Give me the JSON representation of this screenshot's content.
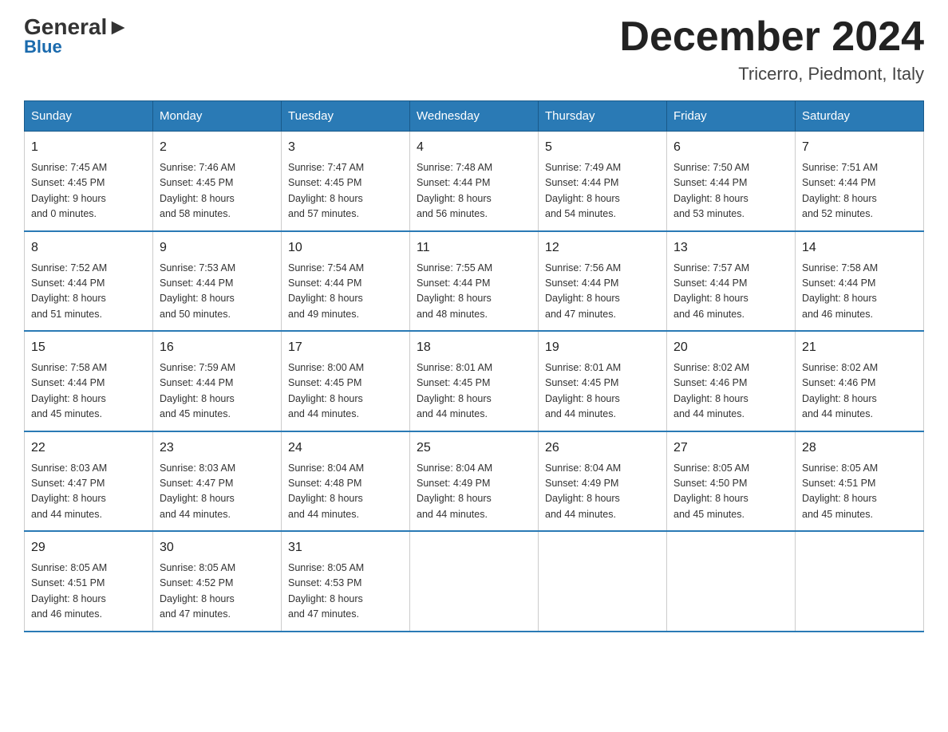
{
  "header": {
    "logo_general": "General",
    "logo_blue": "Blue",
    "month_title": "December 2024",
    "location": "Tricerro, Piedmont, Italy"
  },
  "days_of_week": [
    "Sunday",
    "Monday",
    "Tuesday",
    "Wednesday",
    "Thursday",
    "Friday",
    "Saturday"
  ],
  "weeks": [
    [
      {
        "day": "1",
        "sunrise": "7:45 AM",
        "sunset": "4:45 PM",
        "daylight_h": "9",
        "daylight_m": "0"
      },
      {
        "day": "2",
        "sunrise": "7:46 AM",
        "sunset": "4:45 PM",
        "daylight_h": "8",
        "daylight_m": "58"
      },
      {
        "day": "3",
        "sunrise": "7:47 AM",
        "sunset": "4:45 PM",
        "daylight_h": "8",
        "daylight_m": "57"
      },
      {
        "day": "4",
        "sunrise": "7:48 AM",
        "sunset": "4:44 PM",
        "daylight_h": "8",
        "daylight_m": "56"
      },
      {
        "day": "5",
        "sunrise": "7:49 AM",
        "sunset": "4:44 PM",
        "daylight_h": "8",
        "daylight_m": "54"
      },
      {
        "day": "6",
        "sunrise": "7:50 AM",
        "sunset": "4:44 PM",
        "daylight_h": "8",
        "daylight_m": "53"
      },
      {
        "day": "7",
        "sunrise": "7:51 AM",
        "sunset": "4:44 PM",
        "daylight_h": "8",
        "daylight_m": "52"
      }
    ],
    [
      {
        "day": "8",
        "sunrise": "7:52 AM",
        "sunset": "4:44 PM",
        "daylight_h": "8",
        "daylight_m": "51"
      },
      {
        "day": "9",
        "sunrise": "7:53 AM",
        "sunset": "4:44 PM",
        "daylight_h": "8",
        "daylight_m": "50"
      },
      {
        "day": "10",
        "sunrise": "7:54 AM",
        "sunset": "4:44 PM",
        "daylight_h": "8",
        "daylight_m": "49"
      },
      {
        "day": "11",
        "sunrise": "7:55 AM",
        "sunset": "4:44 PM",
        "daylight_h": "8",
        "daylight_m": "48"
      },
      {
        "day": "12",
        "sunrise": "7:56 AM",
        "sunset": "4:44 PM",
        "daylight_h": "8",
        "daylight_m": "47"
      },
      {
        "day": "13",
        "sunrise": "7:57 AM",
        "sunset": "4:44 PM",
        "daylight_h": "8",
        "daylight_m": "46"
      },
      {
        "day": "14",
        "sunrise": "7:58 AM",
        "sunset": "4:44 PM",
        "daylight_h": "8",
        "daylight_m": "46"
      }
    ],
    [
      {
        "day": "15",
        "sunrise": "7:58 AM",
        "sunset": "4:44 PM",
        "daylight_h": "8",
        "daylight_m": "45"
      },
      {
        "day": "16",
        "sunrise": "7:59 AM",
        "sunset": "4:44 PM",
        "daylight_h": "8",
        "daylight_m": "45"
      },
      {
        "day": "17",
        "sunrise": "8:00 AM",
        "sunset": "4:45 PM",
        "daylight_h": "8",
        "daylight_m": "44"
      },
      {
        "day": "18",
        "sunrise": "8:01 AM",
        "sunset": "4:45 PM",
        "daylight_h": "8",
        "daylight_m": "44"
      },
      {
        "day": "19",
        "sunrise": "8:01 AM",
        "sunset": "4:45 PM",
        "daylight_h": "8",
        "daylight_m": "44"
      },
      {
        "day": "20",
        "sunrise": "8:02 AM",
        "sunset": "4:46 PM",
        "daylight_h": "8",
        "daylight_m": "44"
      },
      {
        "day": "21",
        "sunrise": "8:02 AM",
        "sunset": "4:46 PM",
        "daylight_h": "8",
        "daylight_m": "44"
      }
    ],
    [
      {
        "day": "22",
        "sunrise": "8:03 AM",
        "sunset": "4:47 PM",
        "daylight_h": "8",
        "daylight_m": "44"
      },
      {
        "day": "23",
        "sunrise": "8:03 AM",
        "sunset": "4:47 PM",
        "daylight_h": "8",
        "daylight_m": "44"
      },
      {
        "day": "24",
        "sunrise": "8:04 AM",
        "sunset": "4:48 PM",
        "daylight_h": "8",
        "daylight_m": "44"
      },
      {
        "day": "25",
        "sunrise": "8:04 AM",
        "sunset": "4:49 PM",
        "daylight_h": "8",
        "daylight_m": "44"
      },
      {
        "day": "26",
        "sunrise": "8:04 AM",
        "sunset": "4:49 PM",
        "daylight_h": "8",
        "daylight_m": "44"
      },
      {
        "day": "27",
        "sunrise": "8:05 AM",
        "sunset": "4:50 PM",
        "daylight_h": "8",
        "daylight_m": "45"
      },
      {
        "day": "28",
        "sunrise": "8:05 AM",
        "sunset": "4:51 PM",
        "daylight_h": "8",
        "daylight_m": "45"
      }
    ],
    [
      {
        "day": "29",
        "sunrise": "8:05 AM",
        "sunset": "4:51 PM",
        "daylight_h": "8",
        "daylight_m": "46"
      },
      {
        "day": "30",
        "sunrise": "8:05 AM",
        "sunset": "4:52 PM",
        "daylight_h": "8",
        "daylight_m": "47"
      },
      {
        "day": "31",
        "sunrise": "8:05 AM",
        "sunset": "4:53 PM",
        "daylight_h": "8",
        "daylight_m": "47"
      },
      null,
      null,
      null,
      null
    ]
  ],
  "labels": {
    "sunrise": "Sunrise:",
    "sunset": "Sunset:",
    "daylight": "Daylight:",
    "hours_suffix": "hours",
    "and": "and",
    "minutes": "minutes."
  }
}
